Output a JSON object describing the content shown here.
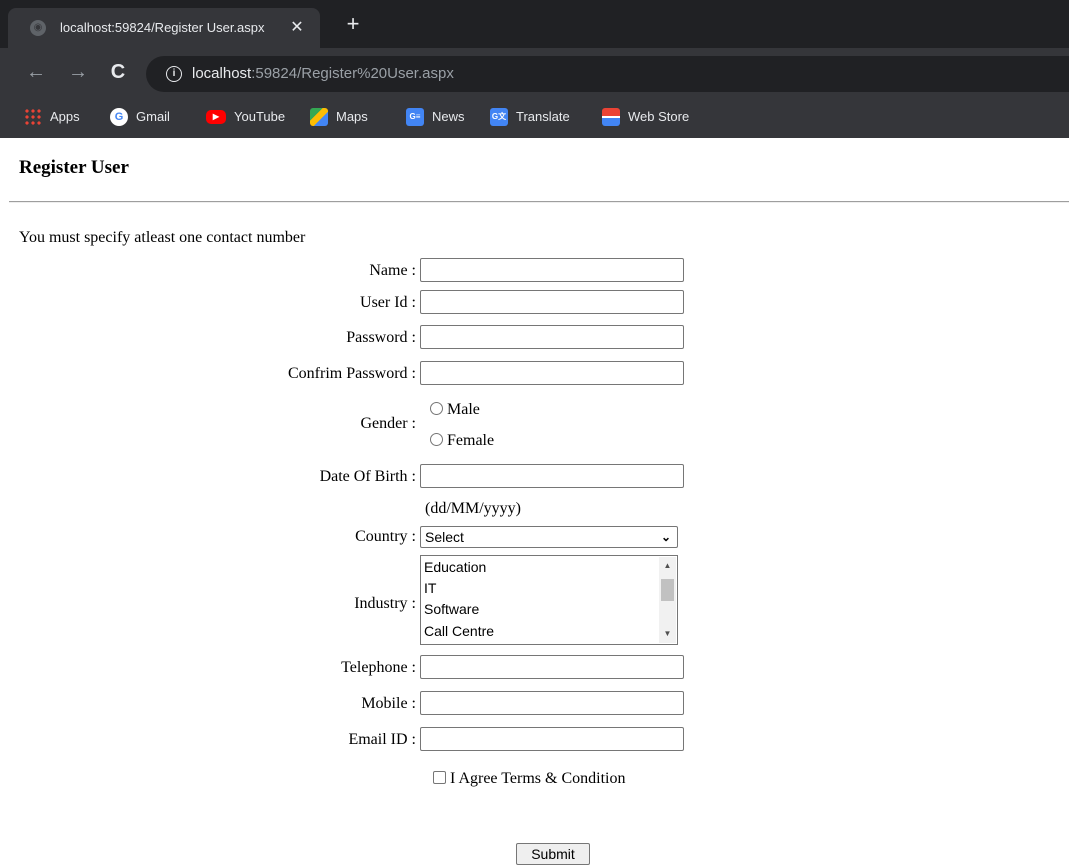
{
  "browser": {
    "tab_title": "localhost:59824/Register User.aspx",
    "tab_close": "✕",
    "new_tab": "+",
    "nav": {
      "back": "←",
      "forward": "→",
      "reload": "C"
    },
    "url_host": "localhost",
    "url_rest": ":59824/Register%20User.aspx",
    "bookmarks": [
      "Apps",
      "Gmail",
      "YouTube",
      "Maps",
      "News",
      "Translate",
      "Web Store"
    ]
  },
  "page": {
    "title": "Register User",
    "notice": "You must specify atleast one contact number"
  },
  "form": {
    "name_label": "Name :",
    "userid_label": "User Id :",
    "password_label": "Password :",
    "confirm_label": "Confrim Password :",
    "gender_label": "Gender :",
    "gender_options": [
      "Male",
      "Female"
    ],
    "dob_label": "Date Of Birth :",
    "dob_hint": "(dd/MM/yyyy)",
    "country_label": "Country :",
    "country_selected": "Select",
    "industry_label": "Industry :",
    "industry_options": [
      "Education",
      "IT",
      "Software",
      "Call Centre"
    ],
    "telephone_label": "Telephone :",
    "mobile_label": "Mobile :",
    "email_label": "Email ID :",
    "agree_label": "I Agree Terms & Condition",
    "submit_label": "Submit"
  }
}
